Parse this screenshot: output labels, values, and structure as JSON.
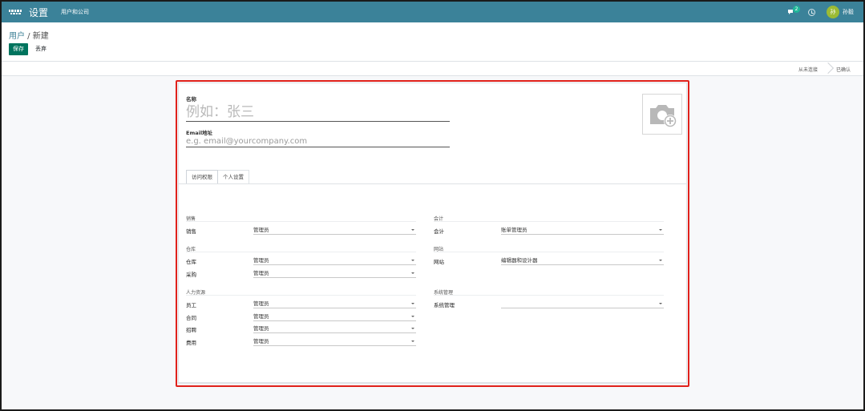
{
  "navbar": {
    "app_title": "设置",
    "menu_item": "用户和公司",
    "chat_badge": "2",
    "user_initial": "孙",
    "user_name": "孙毅"
  },
  "control_panel": {
    "breadcrumb_parent": "用户",
    "breadcrumb_sep": " / ",
    "breadcrumb_current": "新建",
    "save_label": "保存",
    "discard_label": "丢弃"
  },
  "status_bar": {
    "step_never_connected": "从未连接",
    "step_confirmed": "已确认"
  },
  "form": {
    "name_label": "名称",
    "name_placeholder": "例如：张三",
    "email_label": "Email地址",
    "email_placeholder": "e.g. email@yourcompany.com",
    "tabs": [
      "访问权限",
      "个人设置"
    ]
  },
  "access_rights": {
    "left": [
      {
        "group": "销售",
        "rows": [
          {
            "label": "销售",
            "value": "管理员"
          }
        ]
      },
      {
        "group": "仓库",
        "rows": [
          {
            "label": "仓库",
            "value": "管理员"
          },
          {
            "label": "采购",
            "value": "管理员"
          }
        ]
      },
      {
        "group": "人力资源",
        "rows": [
          {
            "label": "员工",
            "value": "管理员"
          },
          {
            "label": "合同",
            "value": "管理员"
          },
          {
            "label": "招聘",
            "value": "管理员"
          },
          {
            "label": "费用",
            "value": "管理员"
          }
        ]
      }
    ],
    "right": [
      {
        "group": "会计",
        "rows": [
          {
            "label": "会计",
            "value": "账单管理员"
          }
        ]
      },
      {
        "group": "网站",
        "rows": [
          {
            "label": "网站",
            "value": "编辑器和设计器"
          }
        ]
      },
      {
        "group": "系统管理",
        "rows": [
          {
            "label": "系统管理",
            "value": ""
          }
        ]
      }
    ]
  },
  "colors": {
    "navbar": "#3b8299",
    "primary_button": "#00745e",
    "highlight": "#e0211b",
    "avatar": "#9bbb34"
  }
}
